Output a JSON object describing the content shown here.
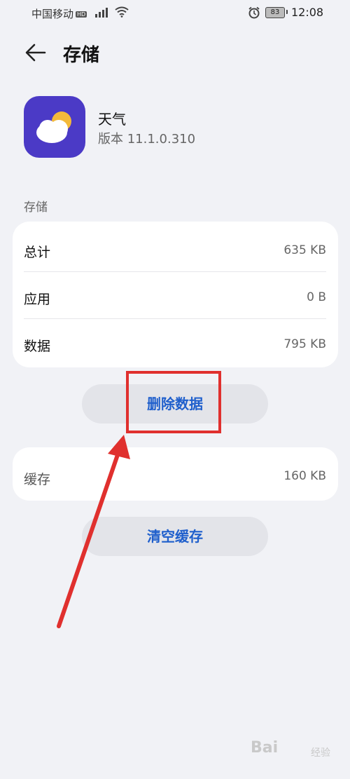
{
  "status_bar": {
    "carrier": "中国移动",
    "hd": "HD",
    "battery": "83",
    "time": "12:08"
  },
  "header": {
    "title": "存储",
    "back_icon": "arrow-left-icon"
  },
  "app": {
    "name": "天气",
    "version": "版本 11.1.0.310",
    "icon": "weather-cloud-sun-icon",
    "icon_color": "#4b3ac6"
  },
  "storage": {
    "section_label": "存储",
    "rows": [
      {
        "label": "总计",
        "value": "635 KB"
      },
      {
        "label": "应用",
        "value": "0 B"
      },
      {
        "label": "数据",
        "value": "795 KB"
      }
    ],
    "delete_button": "删除数据"
  },
  "cache": {
    "label": "缓存",
    "value": "160 KB",
    "clear_button": "清空缓存"
  },
  "accent_color": "#1f5fcc",
  "annotation_color": "#e0302e",
  "watermark": {
    "text": "Bai",
    "sub": "经验"
  }
}
